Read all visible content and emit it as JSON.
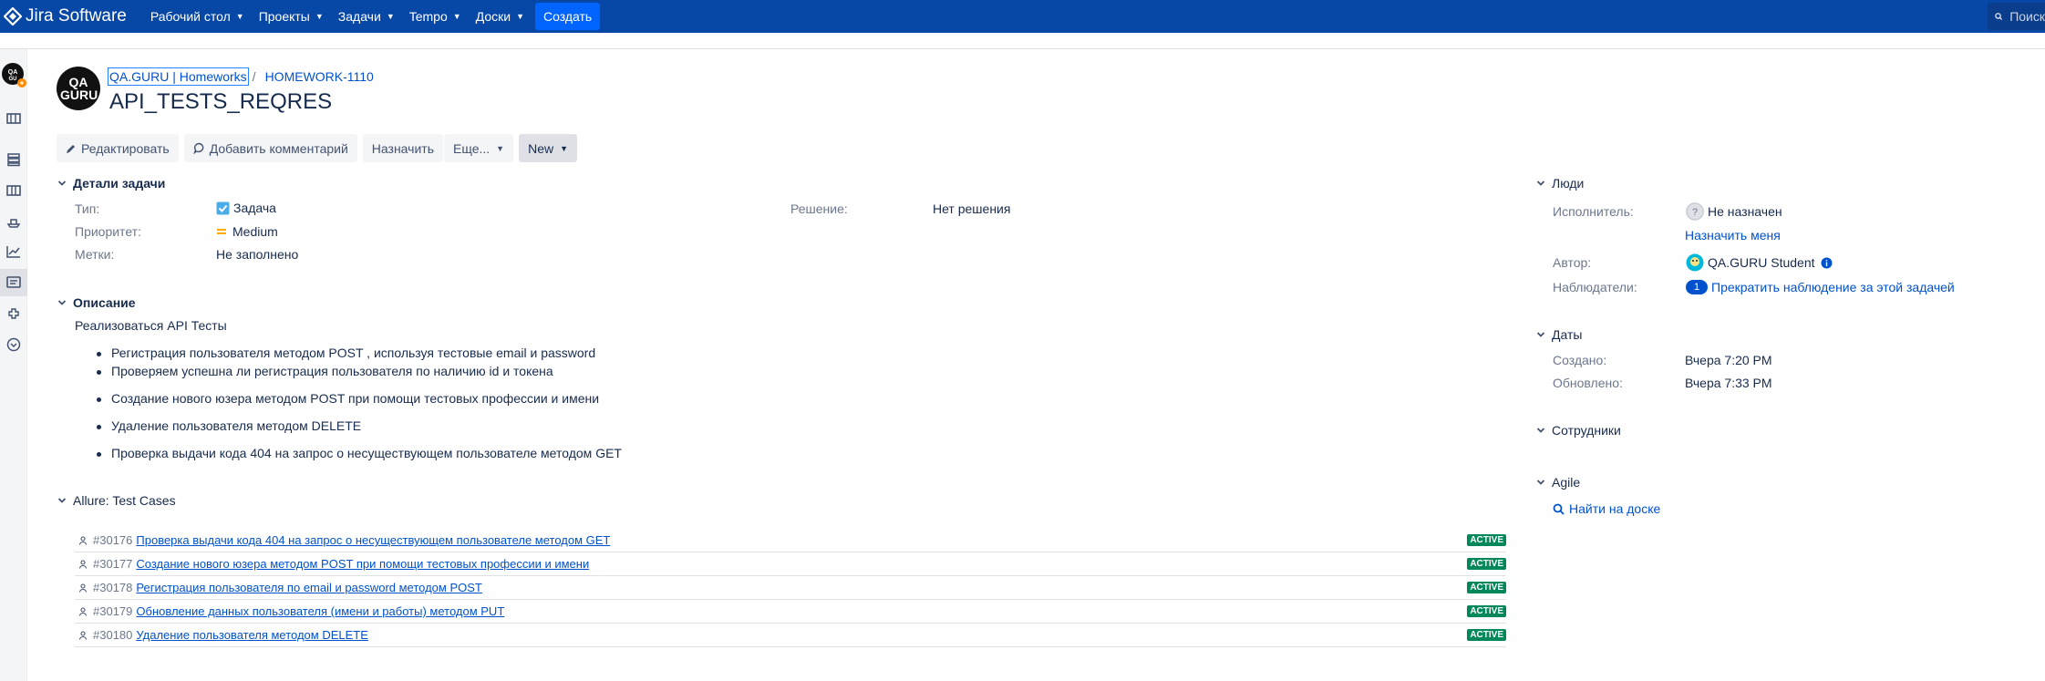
{
  "topnav": {
    "product": "Jira Software",
    "items": [
      {
        "label": "Рабочий стол"
      },
      {
        "label": "Проекты"
      },
      {
        "label": "Задачи"
      },
      {
        "label": "Tempo"
      },
      {
        "label": "Доски"
      }
    ],
    "create": "Создать",
    "search_placeholder": "Поиск"
  },
  "header": {
    "project_avatar_text": "QA GURU",
    "breadcrumb_project": "QA.GURU | Homeworks",
    "breadcrumb_issue": "HOMEWORK-1110",
    "title": "API_TESTS_REQRES"
  },
  "toolbar": {
    "edit": "Редактировать",
    "comment": "Добавить комментарий",
    "assign": "Назначить",
    "more": "Еще...",
    "status": "New"
  },
  "details": {
    "heading": "Детали задачи",
    "type_label": "Тип:",
    "type_value": "Задача",
    "priority_label": "Приоритет:",
    "priority_value": "Medium",
    "labels_label": "Метки:",
    "labels_value": "Не заполнено",
    "resolution_label": "Решение:",
    "resolution_value": "Нет решения"
  },
  "description": {
    "heading": "Описание",
    "intro": "Реализоваться API Тесты",
    "bullets": [
      "Регистрация пользователя методом POST , используя тестовые email и password",
      "Проверяем успешна ли регистрация пользователя по наличию id и токена",
      "Создание нового юзера методом POST при помощи тестовых профессии и имени",
      "Удаление пользователя методом DELETE",
      "Проверка выдачи кода 404 на запрос о несуществующем пользователе методом GET"
    ]
  },
  "allure": {
    "heading": "Allure: Test Cases",
    "rows": [
      {
        "id": "#30176",
        "title": "Проверка выдачи кода 404 на запрос о несуществующем пользователе методом GET",
        "status": "ACTIVE"
      },
      {
        "id": "#30177",
        "title": "Создание нового юзера методом POST при помощи тестовых профессии и имени",
        "status": "ACTIVE"
      },
      {
        "id": "#30178",
        "title": "Регистрация пользователя по email и password методом POST",
        "status": "ACTIVE"
      },
      {
        "id": "#30179",
        "title": "Обновление данных пользователя (имени и работы) методом PUT",
        "status": "ACTIVE"
      },
      {
        "id": "#30180",
        "title": "Удаление пользователя методом DELETE",
        "status": "ACTIVE"
      }
    ]
  },
  "people": {
    "heading": "Люди",
    "assignee_label": "Исполнитель:",
    "assignee_value": "Не назначен",
    "assign_me": "Назначить меня",
    "reporter_label": "Автор:",
    "reporter_value": "QA.GURU Student",
    "watchers_label": "Наблюдатели:",
    "watchers_count": "1",
    "watchers_action": "Прекратить наблюдение за этой задачей"
  },
  "dates": {
    "heading": "Даты",
    "created_label": "Создано:",
    "created_value": "Вчера 7:20 PM",
    "updated_label": "Обновлено:",
    "updated_value": "Вчера 7:33 PM"
  },
  "staff": {
    "heading": "Сотрудники"
  },
  "agile": {
    "heading": "Agile",
    "find_on_board": "Найти на доске"
  },
  "colors": {
    "nav": "#0747a6",
    "create": "#0065ff",
    "link": "#0052cc",
    "active_badge": "#00875a"
  }
}
